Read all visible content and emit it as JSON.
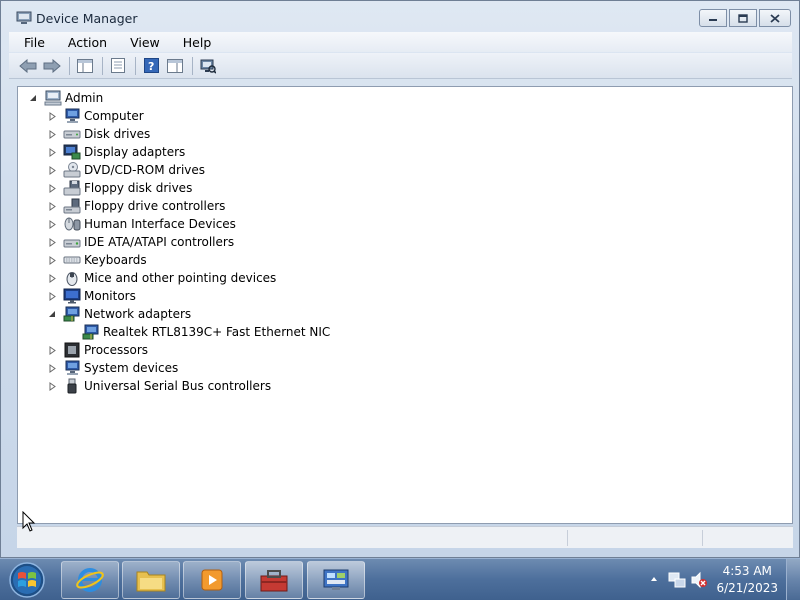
{
  "window": {
    "title": "Device Manager",
    "icon": "device-manager-icon",
    "controls": [
      "minimize",
      "maximize",
      "close"
    ]
  },
  "menu": [
    "File",
    "Action",
    "View",
    "Help"
  ],
  "toolbar": {
    "buttons": [
      "back-icon",
      "forward-icon",
      "show-hide-console-tree-icon",
      "properties-icon",
      "help-icon",
      "show-hide-action-pane-icon",
      "scan-hardware-icon"
    ]
  },
  "tree": {
    "root": {
      "label": "Admin",
      "expanded": true
    },
    "items": [
      {
        "label": "Computer",
        "icon": "computer-icon",
        "expanded": false
      },
      {
        "label": "Disk drives",
        "icon": "disk-drive-icon",
        "expanded": false
      },
      {
        "label": "Display adapters",
        "icon": "display-adapter-icon",
        "expanded": false
      },
      {
        "label": "DVD/CD-ROM drives",
        "icon": "dvd-drive-icon",
        "expanded": false
      },
      {
        "label": "Floppy disk drives",
        "icon": "floppy-drive-icon",
        "expanded": false
      },
      {
        "label": "Floppy drive controllers",
        "icon": "floppy-controller-icon",
        "expanded": false
      },
      {
        "label": "Human Interface Devices",
        "icon": "hid-icon",
        "expanded": false
      },
      {
        "label": "IDE ATA/ATAPI controllers",
        "icon": "ide-controller-icon",
        "expanded": false
      },
      {
        "label": "Keyboards",
        "icon": "keyboard-icon",
        "expanded": false
      },
      {
        "label": "Mice and other pointing devices",
        "icon": "mouse-icon",
        "expanded": false
      },
      {
        "label": "Monitors",
        "icon": "monitor-icon",
        "expanded": false
      },
      {
        "label": "Network adapters",
        "icon": "network-adapter-icon",
        "expanded": true,
        "children": [
          {
            "label": "Realtek RTL8139C+ Fast Ethernet NIC",
            "icon": "network-card-icon"
          }
        ]
      },
      {
        "label": "Processors",
        "icon": "processor-icon",
        "expanded": false
      },
      {
        "label": "System devices",
        "icon": "system-devices-icon",
        "expanded": false
      },
      {
        "label": "Universal Serial Bus controllers",
        "icon": "usb-icon",
        "expanded": false
      }
    ]
  },
  "taskbar": {
    "start": "windows-start-icon",
    "pinned": [
      "internet-explorer-icon",
      "windows-explorer-icon",
      "media-player-icon",
      "toolbox-icon",
      "control-panel-icon"
    ],
    "tray_icons": [
      "show-hidden-icons-icon",
      "network-icon",
      "volume-muted-icon"
    ],
    "time": "4:53 AM",
    "date": "6/21/2023"
  }
}
